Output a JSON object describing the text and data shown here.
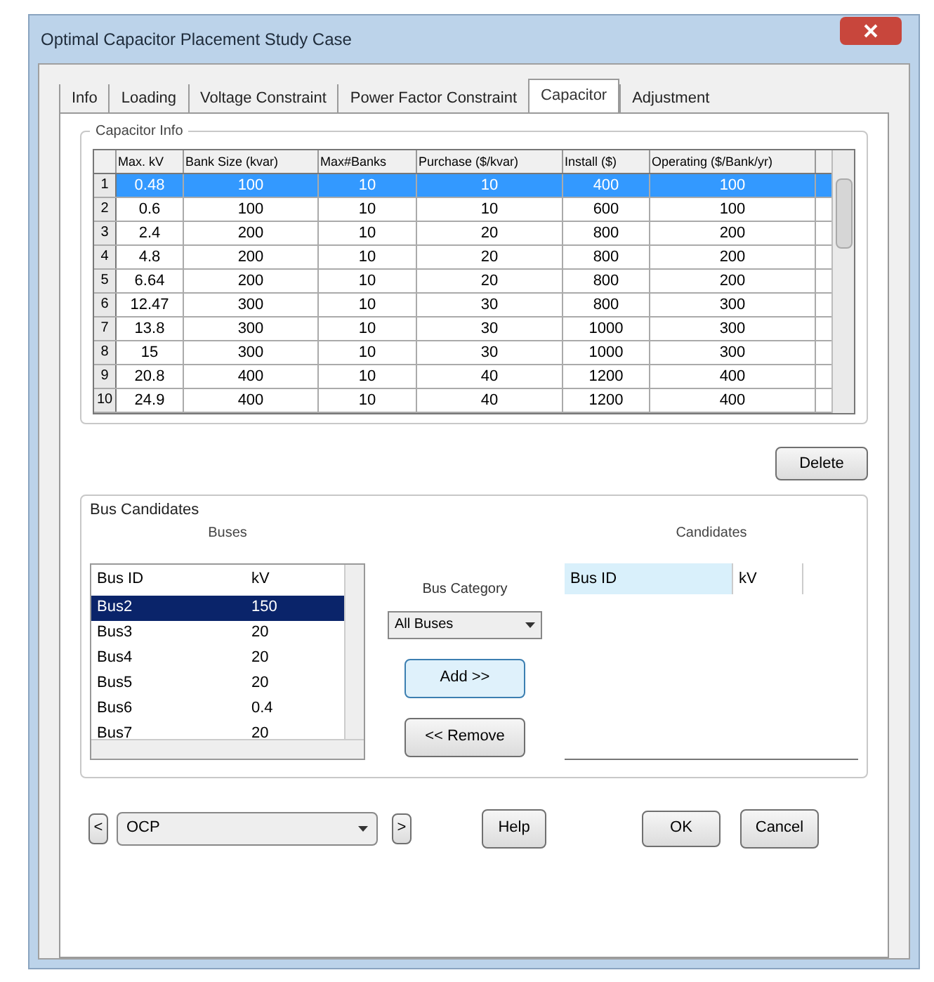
{
  "window": {
    "title": "Optimal Capacitor Placement Study Case"
  },
  "tabs": [
    {
      "label": "Info",
      "selected": false
    },
    {
      "label": "Loading",
      "selected": false
    },
    {
      "label": "Voltage Constraint",
      "selected": false
    },
    {
      "label": "Power Factor Constraint",
      "selected": false
    },
    {
      "label": "Capacitor",
      "selected": true
    },
    {
      "label": "Adjustment",
      "selected": false
    }
  ],
  "capacitor_info": {
    "title": "Capacitor Info",
    "columns": [
      "Max. kV",
      "Bank Size (kvar)",
      "Max#Banks",
      "Purchase ($/kvar)",
      "Install ($)",
      "Operating ($/Bank/yr)"
    ],
    "rows": [
      {
        "index": "1",
        "selected": true,
        "cells": [
          "0.48",
          "100",
          "10",
          "10",
          "400",
          "100"
        ]
      },
      {
        "index": "2",
        "selected": false,
        "cells": [
          "0.6",
          "100",
          "10",
          "10",
          "600",
          "100"
        ]
      },
      {
        "index": "3",
        "selected": false,
        "cells": [
          "2.4",
          "200",
          "10",
          "20",
          "800",
          "200"
        ]
      },
      {
        "index": "4",
        "selected": false,
        "cells": [
          "4.8",
          "200",
          "10",
          "20",
          "800",
          "200"
        ]
      },
      {
        "index": "5",
        "selected": false,
        "cells": [
          "6.64",
          "200",
          "10",
          "20",
          "800",
          "200"
        ]
      },
      {
        "index": "6",
        "selected": false,
        "cells": [
          "12.47",
          "300",
          "10",
          "30",
          "800",
          "300"
        ]
      },
      {
        "index": "7",
        "selected": false,
        "cells": [
          "13.8",
          "300",
          "10",
          "30",
          "1000",
          "300"
        ]
      },
      {
        "index": "8",
        "selected": false,
        "cells": [
          "15",
          "300",
          "10",
          "30",
          "1000",
          "300"
        ]
      },
      {
        "index": "9",
        "selected": false,
        "cells": [
          "20.8",
          "400",
          "10",
          "40",
          "1200",
          "400"
        ]
      },
      {
        "index": "10",
        "selected": false,
        "cells": [
          "24.9",
          "400",
          "10",
          "40",
          "1200",
          "400"
        ]
      }
    ],
    "delete_button": "Delete"
  },
  "bus_candidates": {
    "title": "Bus Candidates",
    "buses": {
      "title": "Buses",
      "columns": [
        "Bus ID",
        "kV"
      ],
      "rows": [
        {
          "selected": true,
          "cells": [
            "Bus2",
            "150"
          ]
        },
        {
          "selected": false,
          "cells": [
            "Bus3",
            "20"
          ]
        },
        {
          "selected": false,
          "cells": [
            "Bus4",
            "20"
          ]
        },
        {
          "selected": false,
          "cells": [
            "Bus5",
            "20"
          ]
        },
        {
          "selected": false,
          "cells": [
            "Bus6",
            "0.4"
          ]
        },
        {
          "selected": false,
          "cells": [
            "Bus7",
            "20"
          ]
        }
      ]
    },
    "bus_category": {
      "label": "Bus Category",
      "value": "All Buses"
    },
    "add_button": "Add >>",
    "remove_button": "<< Remove",
    "candidates": {
      "title": "Candidates",
      "columns": [
        "Bus ID",
        "kV"
      ]
    }
  },
  "footer": {
    "prev_button": "<",
    "study_case": "OCP",
    "next_button": ">",
    "help_button": "Help",
    "ok_button": "OK",
    "cancel_button": "Cancel"
  }
}
